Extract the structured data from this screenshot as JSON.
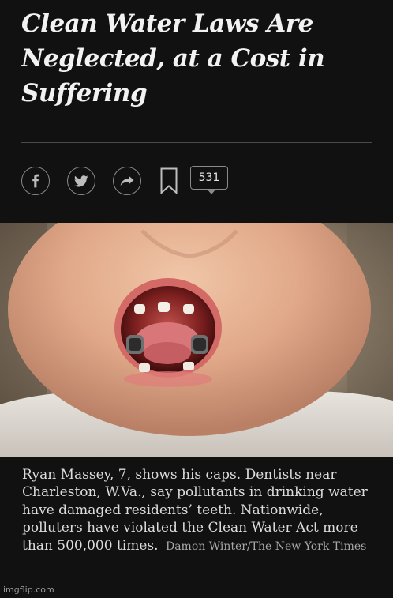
{
  "article": {
    "headline": "Clean Water Laws Are Neglected, at a Cost in Suffering",
    "comment_count": "531"
  },
  "share_bar": {
    "icons": [
      "facebook-icon",
      "twitter-icon",
      "share-arrow-icon",
      "bookmark-icon"
    ]
  },
  "photo": {
    "subject": "child-open-mouth-with-metal-caps"
  },
  "caption": {
    "text": "Ryan Massey, 7, shows his caps. Dentists near Charleston, W.Va., say pollutants in drinking water have damaged residents’ teeth. Nationwide, polluters have violated the Clean Water Act more than 500,000 times.",
    "credit": "Damon Winter/The New York Times"
  },
  "watermark": "imgflip.com",
  "colors": {
    "background": "#111111",
    "text": "#f2f2f2",
    "icon_stroke": "#8a8a8a"
  }
}
